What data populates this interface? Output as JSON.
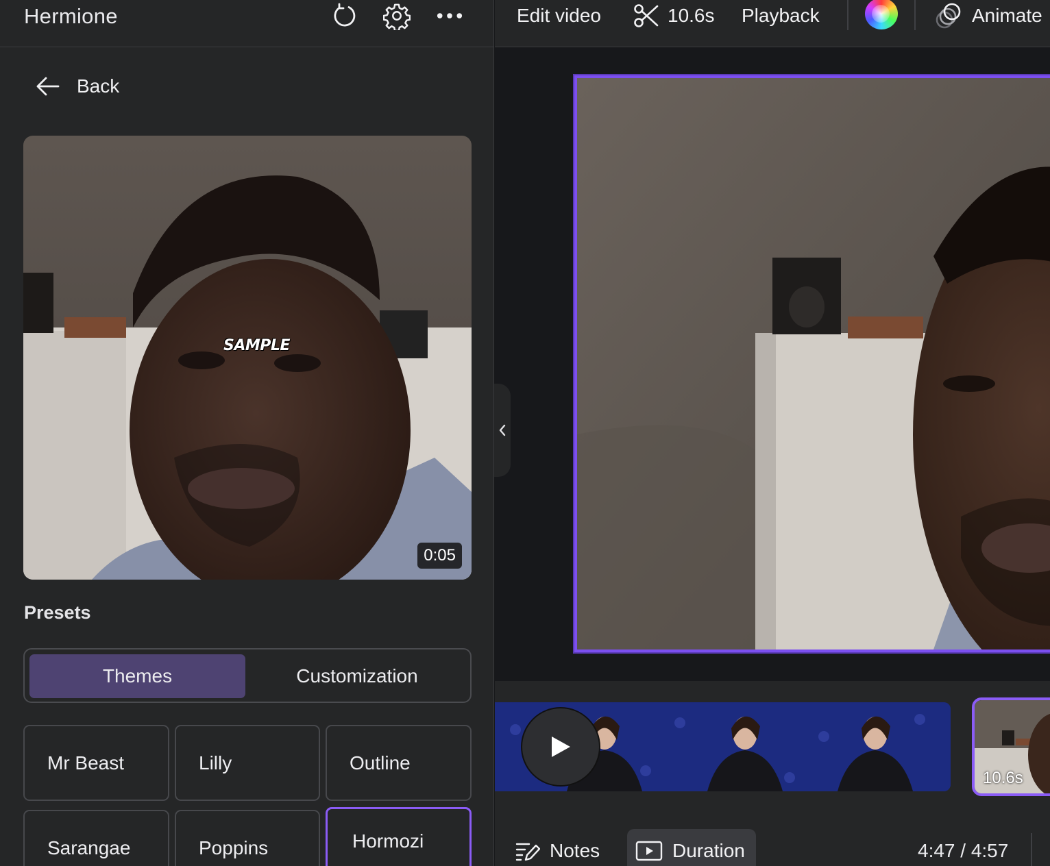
{
  "header": {
    "title": "Hermione",
    "icons": [
      "refresh-icon",
      "gear-icon",
      "more-icon"
    ]
  },
  "toolbar": {
    "edit_video": "Edit video",
    "trim_duration": "10.6s",
    "playback": "Playback",
    "animate": "Animate"
  },
  "panel": {
    "back_label": "Back",
    "preview_caption": "SAMPLE",
    "preview_time": "0:05",
    "section_title": "Presets",
    "tabs": [
      "Themes",
      "Customization"
    ],
    "active_tab": "Themes",
    "presets": [
      "Mr Beast",
      "Lilly",
      "Outline",
      "Sarangae",
      "Poppins",
      "Hormozi"
    ],
    "selected_preset": "Hormozi"
  },
  "timeline": {
    "clip2_duration": "10.6s"
  },
  "footer": {
    "notes": "Notes",
    "duration": "Duration",
    "time": "4:47 / 4:57"
  },
  "colors": {
    "accent": "#8b5cf6",
    "active_tab_bg": "#4e4372",
    "panel_bg": "#252627"
  }
}
